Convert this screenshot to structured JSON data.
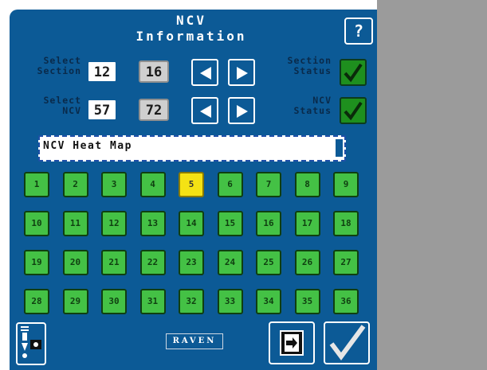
{
  "header": {
    "title_line1": "NCV",
    "title_line2": "Information",
    "help_label": "?"
  },
  "section": {
    "label_line1": "Select",
    "label_line2": "Section",
    "current": "12",
    "total": "16",
    "status_line1": "Section",
    "status_line2": "Status"
  },
  "ncv": {
    "label_line1": "Select",
    "label_line2": "NCV",
    "current": "57",
    "total": "72",
    "status_line1": "NCV",
    "status_line2": "Status"
  },
  "view_select": {
    "value": "NCV Heat Map"
  },
  "grid": {
    "selected": "5",
    "buttons": [
      "1",
      "2",
      "3",
      "4",
      "5",
      "6",
      "7",
      "8",
      "9",
      "10",
      "11",
      "12",
      "13",
      "14",
      "15",
      "16",
      "17",
      "18",
      "19",
      "20",
      "21",
      "22",
      "23",
      "24",
      "25",
      "26",
      "27",
      "28",
      "29",
      "30",
      "31",
      "32",
      "33",
      "34",
      "35",
      "36"
    ]
  },
  "footer": {
    "logo_text": "RAVEN"
  },
  "colors": {
    "panel_blue": "#0c5a96",
    "button_green": "#44c145",
    "selected_yellow": "#f4e214",
    "status_green": "#1e8f1e"
  },
  "icons": [
    "help-icon",
    "left-arrow-icon",
    "right-arrow-icon",
    "check-icon",
    "nozzle-camera-icon",
    "exit-icon",
    "accept-check-icon"
  ]
}
